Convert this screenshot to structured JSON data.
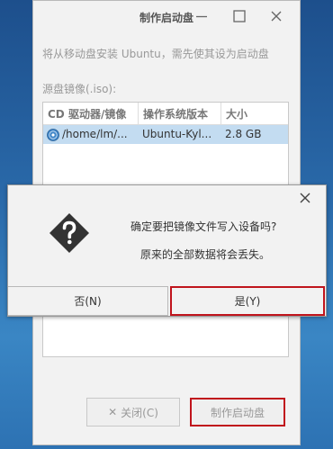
{
  "window": {
    "title": "制作启动盘",
    "instruction": "将从移动盘安装 Ubuntu，需先使其设为启动盘",
    "source_label": "源盘镜像(.iso):"
  },
  "table": {
    "headers": [
      "CD 驱动器/镜像",
      "操作系统版本",
      "大小"
    ],
    "rows": [
      {
        "path": "/home/lm/...",
        "os": "Ubuntu-Kyl...",
        "size": "2.8 GB",
        "icon": "cd-disc-icon"
      }
    ]
  },
  "buttons": {
    "close_label": "关闭(C)",
    "make_label": "制作启动盘"
  },
  "dialog": {
    "message1": "确定要把镜像文件写入设备吗?",
    "message2": "原来的全部数据将会丢失。",
    "no_label": "否(N)",
    "yes_label": "是(Y)",
    "icon": "question-warning-icon"
  },
  "colors": {
    "highlight": "#c0141c",
    "selected_row": "#c3dcf1"
  }
}
